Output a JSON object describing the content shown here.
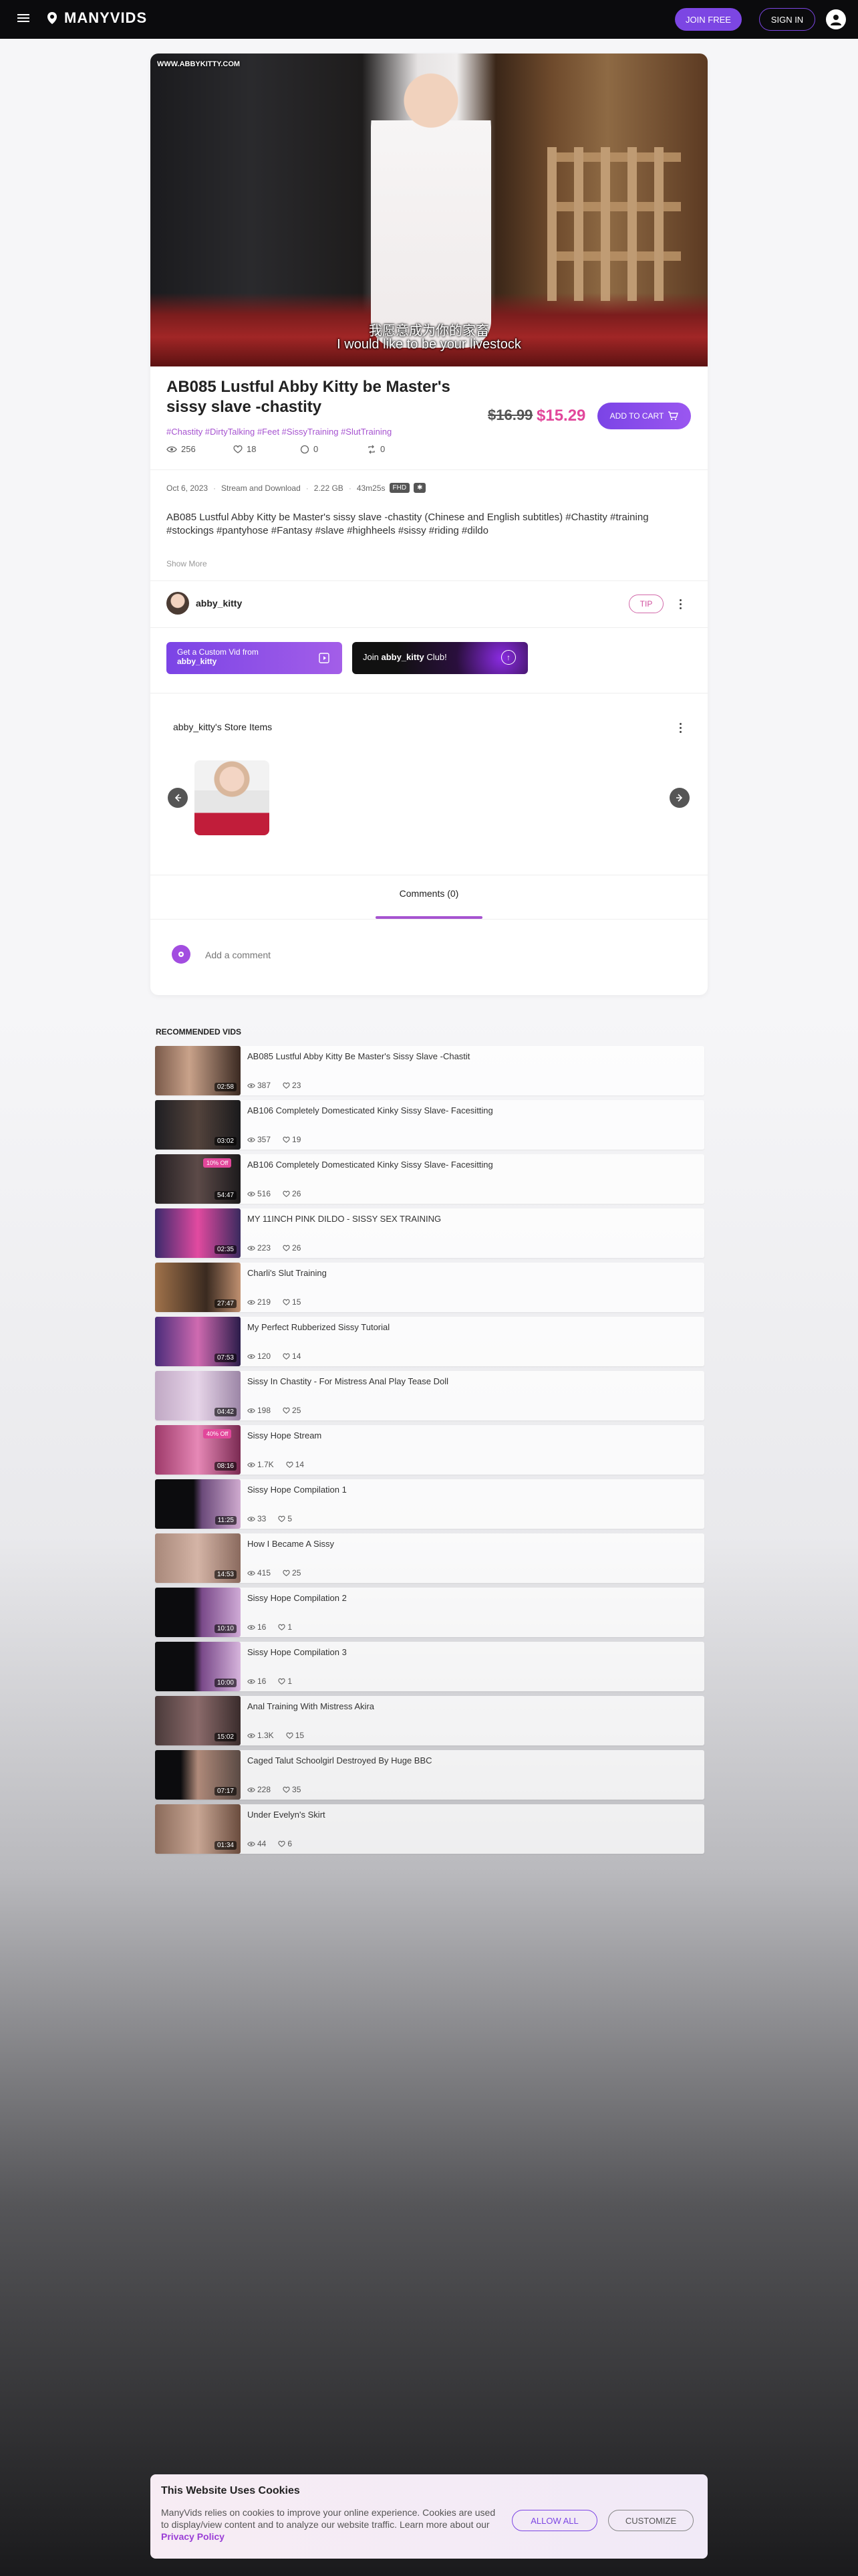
{
  "header": {
    "brand": "MANYVIDS",
    "join_label": "JOIN FREE",
    "signin_label": "SIGN IN"
  },
  "video": {
    "watermark": "WWW.ABBYKITTY.COM",
    "subtitle_cn": "我愿意成为你的家畜",
    "subtitle_en": "I would like to be your livestock"
  },
  "product": {
    "title": "AB085 Lustful Abby Kitty be Master's sissy slave -chastity",
    "tags": "#Chastity #DirtyTalking #Feet #SissyTraining #SlutTraining",
    "views": "256",
    "likes": "18",
    "comments": "0",
    "shares": "0",
    "price_old": "$16.99",
    "price_new": "$15.29",
    "cart_label": "ADD TO CART",
    "date": "Oct 6, 2023",
    "delivery": "Stream and Download",
    "size": "2.22 GB",
    "duration": "43m25s",
    "quality": "FHD",
    "description": "AB085 Lustful Abby Kitty be Master's sissy slave -chastity (Chinese and English subtitles)  #Chastity #training #stockings #pantyhose #Fantasy #slave #highheels #sissy #riding #dildo",
    "show_more": "Show More"
  },
  "creator": {
    "name": "abby_kitty",
    "tip_label": "TIP"
  },
  "promos": {
    "custom_line1": "Get a Custom Vid from",
    "custom_line2": "abby_kitty",
    "club_prefix": "Join ",
    "club_name": "abby_kitty",
    "club_suffix": " Club!"
  },
  "store": {
    "title": "abby_kitty's Store Items"
  },
  "comments": {
    "tab_label": "Comments (0)",
    "placeholder": "Add a comment"
  },
  "recommended": {
    "title": "RECOMMENDED VIDS",
    "items": [
      {
        "title": "AB085 Lustful Abby Kitty Be Master's Sissy Slave -Chastit",
        "duration": "02:58",
        "views": "387",
        "likes": "23",
        "discount": ""
      },
      {
        "title": "AB106 Completely Domesticated Kinky Sissy Slave- Facesitting",
        "duration": "03:02",
        "views": "357",
        "likes": "19",
        "discount": ""
      },
      {
        "title": "AB106 Completely Domesticated Kinky Sissy Slave- Facesitting",
        "duration": "54:47",
        "views": "516",
        "likes": "26",
        "discount": "10% Off"
      },
      {
        "title": "MY 11INCH PINK DILDO - SISSY SEX TRAINING",
        "duration": "02:35",
        "views": "223",
        "likes": "26",
        "discount": ""
      },
      {
        "title": "Charli's Slut Training",
        "duration": "27:47",
        "views": "219",
        "likes": "15",
        "discount": ""
      },
      {
        "title": "My Perfect Rubberized Sissy Tutorial",
        "duration": "07:53",
        "views": "120",
        "likes": "14",
        "discount": ""
      },
      {
        "title": "Sissy In Chastity - For Mistress Anal Play Tease Doll",
        "duration": "04:42",
        "views": "198",
        "likes": "25",
        "discount": ""
      },
      {
        "title": "Sissy Hope Stream",
        "duration": "08:16",
        "views": "1.7K",
        "likes": "14",
        "discount": "40% Off"
      },
      {
        "title": "Sissy Hope Compilation 1",
        "duration": "11:25",
        "views": "33",
        "likes": "5",
        "discount": ""
      },
      {
        "title": "How I Became A Sissy",
        "duration": "14:53",
        "views": "415",
        "likes": "25",
        "discount": ""
      },
      {
        "title": "Sissy Hope Compilation 2",
        "duration": "10:10",
        "views": "16",
        "likes": "1",
        "discount": ""
      },
      {
        "title": "Sissy Hope Compilation 3",
        "duration": "10:00",
        "views": "16",
        "likes": "1",
        "discount": ""
      },
      {
        "title": "Anal Training With Mistress Akira",
        "duration": "15:02",
        "views": "1.3K",
        "likes": "15",
        "discount": ""
      },
      {
        "title": "Caged Talut Schoolgirl Destroyed By Huge BBC",
        "duration": "07:17",
        "views": "228",
        "likes": "35",
        "discount": ""
      },
      {
        "title": "Under Evelyn's Skirt",
        "duration": "01:34",
        "views": "44",
        "likes": "6",
        "discount": ""
      }
    ]
  },
  "cookie": {
    "title": "This Website Uses Cookies",
    "text": "ManyVids relies on cookies to improve your online experience. Cookies are used to display/view content and to analyze our website traffic. Learn more about our ",
    "link": "Privacy Policy",
    "allow_label": "ALLOW ALL",
    "customize_label": "CUSTOMIZE"
  },
  "colors": {
    "accent": "#7c46e3",
    "price": "#e2479b",
    "tag": "#a653d0"
  }
}
